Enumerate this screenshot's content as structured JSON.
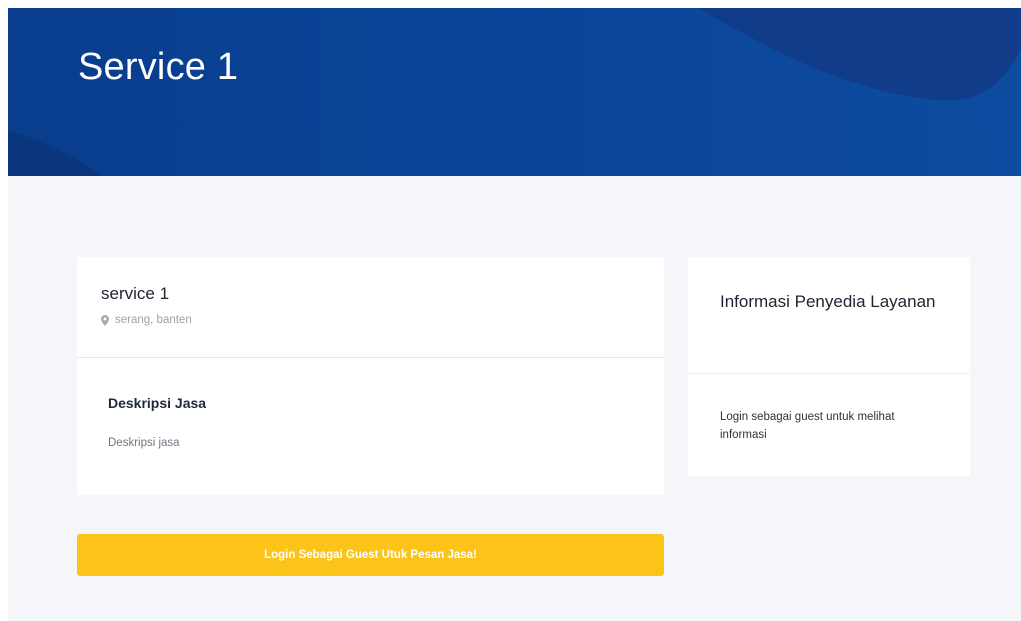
{
  "hero": {
    "title": "Service 1",
    "background_color": "#0b4599"
  },
  "service": {
    "name": "service 1",
    "location_icon": "map-pin-icon",
    "location": "serang, banten",
    "description_heading": "Deskripsi Jasa",
    "description": "Deskripsi jasa"
  },
  "provider_info": {
    "heading": "Informasi Penyedia Layanan",
    "message": "Login sebagai guest untuk melihat informasi"
  },
  "cta": {
    "label": "Login Sebagai Guest Utuk Pesan Jasa!",
    "color": "#fcc418"
  }
}
